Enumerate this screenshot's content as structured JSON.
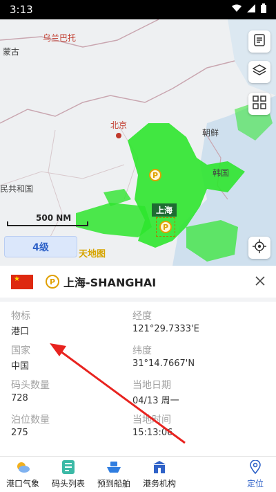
{
  "status": {
    "time": "3:13"
  },
  "map": {
    "labels": {
      "ulaanbaatar": "乌兰巴托",
      "mongolia": "蒙古",
      "beijing": "北京",
      "korea_n": "朝鲜",
      "korea_s": "韩国",
      "prc": "民共和国"
    },
    "scale": "500 NM",
    "level": "4级",
    "port_tag": "上海",
    "watermark": "天地图"
  },
  "panel": {
    "port_name": "上海-SHANGHAI",
    "fields": [
      {
        "label": "物标",
        "value": "港口"
      },
      {
        "label": "经度",
        "value": "121°29.7333'E"
      },
      {
        "label": "国家",
        "value": "中国"
      },
      {
        "label": "纬度",
        "value": "31°14.7667'N"
      },
      {
        "label": "码头数量",
        "value": "728"
      },
      {
        "label": "当地日期",
        "value": "04/13 周一"
      },
      {
        "label": "泊位数量",
        "value": "275"
      },
      {
        "label": "当地时间",
        "value": "15:13:06"
      }
    ]
  },
  "tabs": [
    {
      "label": "港口气象",
      "icon": "weather-icon"
    },
    {
      "label": "码头列表",
      "icon": "list-icon"
    },
    {
      "label": "预到船舶",
      "icon": "ship-icon"
    },
    {
      "label": "港务机构",
      "icon": "building-icon"
    }
  ],
  "locate_label": "定位",
  "colors": {
    "accent": "#2f62c8",
    "ais": "#2ee52e",
    "sea": "#cfe0ee"
  }
}
